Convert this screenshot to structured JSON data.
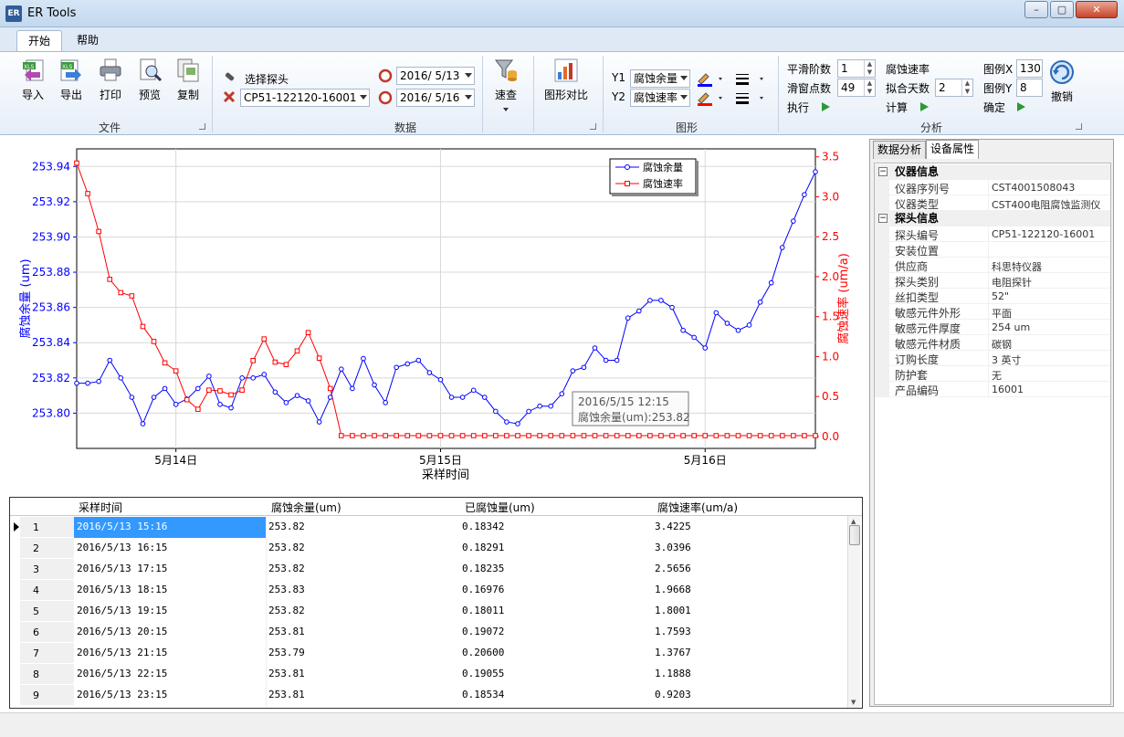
{
  "window": {
    "title": "ER Tools",
    "icon_text": "ER",
    "min": "–",
    "max": "▢",
    "close": "✕"
  },
  "tabs": [
    "开始",
    "帮助"
  ],
  "ribbon": {
    "file": {
      "label": "文件",
      "buttons": [
        "导入",
        "导出",
        "打印",
        "预览",
        "复制"
      ]
    },
    "data": {
      "label": "数据",
      "probe_label": "选择探头",
      "probe_value": "CP51-122120-16001",
      "date_from": "2016/ 5/13",
      "date_to": "2016/ 5/16"
    },
    "query": {
      "label": "速查"
    },
    "compare": {
      "label": "图形对比"
    },
    "graph": {
      "label": "图形",
      "y1_label": "Y1",
      "y1_value": "腐蚀余量",
      "y2_label": "Y2",
      "y2_value": "腐蚀速率",
      "y1_color": "#0000ff",
      "y2_color": "#ff0000"
    },
    "analysis": {
      "label": "分析",
      "smooth_order_label": "平滑阶数",
      "smooth_order": "1",
      "window_label": "滑窗点数",
      "window": "49",
      "execute": "执行",
      "rate_label": "腐蚀速率",
      "fit_days_label": "拟合天数",
      "fit_days": "2",
      "calc": "计算"
    },
    "legend": {
      "x_label": "图例X",
      "x_value": "130",
      "y_label": "图例Y",
      "y_value": "8",
      "confirm": "确定",
      "undo": "撤销"
    }
  },
  "chart_data": {
    "type": "line",
    "xlabel": "采样时间",
    "ylabel": "腐蚀余量 (um)",
    "y2label": "腐蚀速率 (um/a)",
    "x_ticks": [
      "5月14日",
      "5月15日",
      "5月16日"
    ],
    "x_tick_hours": [
      9,
      33,
      57
    ],
    "xlim_hours": [
      0,
      67
    ],
    "ylim": [
      253.78,
      253.95
    ],
    "y_ticks": [
      "253.80",
      "253.82",
      "253.84",
      "253.86",
      "253.88",
      "253.90",
      "253.92",
      "253.94"
    ],
    "y2lim": [
      -0.15,
      3.6
    ],
    "y2_ticks": [
      "0.0",
      "0.5",
      "1.0",
      "1.5",
      "2.0",
      "2.5",
      "3.0",
      "3.5"
    ],
    "grid": true,
    "legend_position": "top-right",
    "series": [
      {
        "name": "腐蚀余量",
        "color": "#0000ff",
        "axis": "left",
        "marker": "circle",
        "values": [
          253.817,
          253.817,
          253.818,
          253.83,
          253.82,
          253.809,
          253.794,
          253.809,
          253.814,
          253.805,
          253.808,
          253.814,
          253.821,
          253.805,
          253.803,
          253.82,
          253.82,
          253.822,
          253.812,
          253.806,
          253.81,
          253.807,
          253.795,
          253.809,
          253.825,
          253.814,
          253.831,
          253.816,
          253.806,
          253.826,
          253.828,
          253.83,
          253.823,
          253.819,
          253.809,
          253.809,
          253.813,
          253.809,
          253.801,
          253.795,
          253.794,
          253.801,
          253.804,
          253.804,
          253.811,
          253.824,
          253.826,
          253.837,
          253.83,
          253.83,
          253.854,
          253.858,
          253.864,
          253.864,
          253.86,
          253.847,
          253.843,
          253.837,
          253.857,
          253.851,
          253.847,
          253.85,
          253.863,
          253.874,
          253.894,
          253.909,
          253.924,
          253.937
        ]
      },
      {
        "name": "腐蚀速率",
        "color": "#ff0000",
        "axis": "right",
        "marker": "square",
        "values": [
          3.4225,
          3.0396,
          2.5656,
          1.9668,
          1.8001,
          1.7593,
          1.3767,
          1.1888,
          0.9203,
          0.82,
          0.46,
          0.34,
          0.58,
          0.57,
          0.52,
          0.58,
          0.95,
          1.22,
          0.93,
          0.9,
          1.07,
          1.3,
          0.98,
          0.6,
          0.01,
          0.01,
          0.01,
          0.01,
          0.01,
          0.01,
          0.01,
          0.01,
          0.01,
          0.01,
          0.01,
          0.01,
          0.01,
          0.01,
          0.01,
          0.01,
          0.01,
          0.01,
          0.01,
          0.01,
          0.01,
          0.01,
          0.01,
          0.01,
          0.01,
          0.01,
          0.01,
          0.01,
          0.01,
          0.01,
          0.01,
          0.01,
          0.01,
          0.01,
          0.01,
          0.01,
          0.01,
          0.01,
          0.01,
          0.01,
          0.01,
          0.01,
          0.01,
          0.01
        ]
      }
    ],
    "tooltip": {
      "line1": "2016/5/15 12:15",
      "line2": "腐蚀余量(um):253.82"
    }
  },
  "table": {
    "columns": [
      "采样时间",
      "腐蚀余量(um)",
      "已腐蚀量(um)",
      "腐蚀速率(um/a)"
    ],
    "rows": [
      {
        "n": "1",
        "time": "2016/5/13 15:16",
        "remain": "253.82",
        "corroded": "0.18342",
        "rate": "3.4225"
      },
      {
        "n": "2",
        "time": "2016/5/13 16:15",
        "remain": "253.82",
        "corroded": "0.18291",
        "rate": "3.0396"
      },
      {
        "n": "3",
        "time": "2016/5/13 17:15",
        "remain": "253.82",
        "corroded": "0.18235",
        "rate": "2.5656"
      },
      {
        "n": "4",
        "time": "2016/5/13 18:15",
        "remain": "253.83",
        "corroded": "0.16976",
        "rate": "1.9668"
      },
      {
        "n": "5",
        "time": "2016/5/13 19:15",
        "remain": "253.82",
        "corroded": "0.18011",
        "rate": "1.8001"
      },
      {
        "n": "6",
        "time": "2016/5/13 20:15",
        "remain": "253.81",
        "corroded": "0.19072",
        "rate": "1.7593"
      },
      {
        "n": "7",
        "time": "2016/5/13 21:15",
        "remain": "253.79",
        "corroded": "0.20600",
        "rate": "1.3767"
      },
      {
        "n": "8",
        "time": "2016/5/13 22:15",
        "remain": "253.81",
        "corroded": "0.19055",
        "rate": "1.1888"
      },
      {
        "n": "9",
        "time": "2016/5/13 23:15",
        "remain": "253.81",
        "corroded": "0.18534",
        "rate": "0.9203"
      }
    ]
  },
  "panel": {
    "tabs": [
      "数据分析",
      "设备属性"
    ],
    "instrument": {
      "title": "仪器信息",
      "rows": [
        {
          "k": "仪器序列号",
          "v": "CST4001508043"
        },
        {
          "k": "仪器类型",
          "v": "CST400电阻腐蚀监测仪"
        }
      ]
    },
    "probe": {
      "title": "探头信息",
      "rows": [
        {
          "k": "探头编号",
          "v": "CP51-122120-16001"
        },
        {
          "k": "安装位置",
          "v": ""
        },
        {
          "k": "供应商",
          "v": "科思特仪器"
        },
        {
          "k": "探头类别",
          "v": "电阻探针"
        },
        {
          "k": "丝扣类型",
          "v": "52\""
        },
        {
          "k": "敏感元件外形",
          "v": "平面"
        },
        {
          "k": "敏感元件厚度",
          "v": "254 um"
        },
        {
          "k": "敏感元件材质",
          "v": "碳钢"
        },
        {
          "k": "订购长度",
          "v": "3 英寸"
        },
        {
          "k": "防护套",
          "v": "无"
        },
        {
          "k": "产品编码",
          "v": "16001"
        }
      ]
    }
  }
}
